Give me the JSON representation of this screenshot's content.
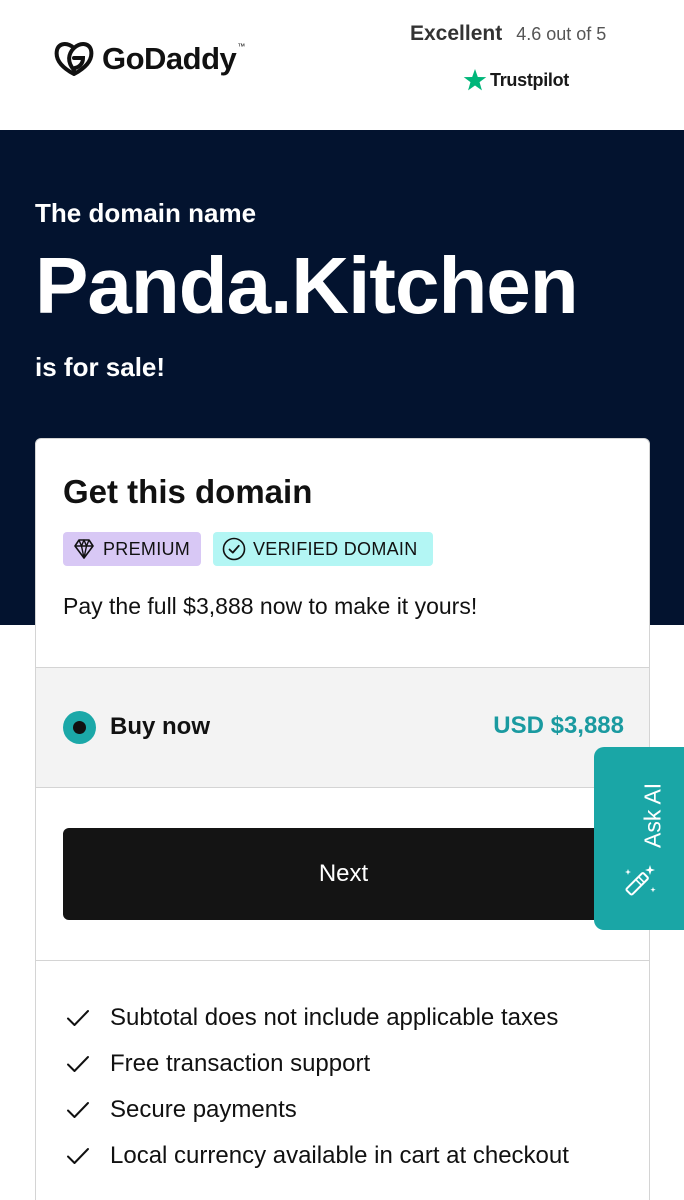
{
  "header": {
    "logo_text": "GoDaddy",
    "logo_tm": "™",
    "logo_icon": "godaddy-logo-icon",
    "rating_label": "Excellent",
    "rating_score": "4.6 out of 5",
    "trustpilot_label": "Trustpilot",
    "trustpilot_icon": "star-icon",
    "trustpilot_color": "#00b67a"
  },
  "hero": {
    "prefix": "The domain name",
    "domain": "Panda.Kitchen",
    "suffix": "is for sale!",
    "background_color": "#03132f"
  },
  "card": {
    "title": "Get this domain",
    "badges": [
      {
        "label": "PREMIUM",
        "icon": "diamond-icon",
        "color": "#d8c8f5"
      },
      {
        "label": "VERIFIED DOMAIN",
        "icon": "check-circle-icon",
        "color": "#b3f6f4"
      }
    ],
    "description": "Pay the full $3,888 now to make it yours!",
    "option": {
      "label": "Buy now",
      "price": "USD $3,888",
      "selected": true,
      "accent_color": "#1ba8a8"
    },
    "next_label": "Next",
    "features": [
      "Subtotal does not include applicable taxes",
      "Free transaction support",
      "Secure payments",
      "Local currency available in cart at checkout"
    ]
  },
  "ask_ai": {
    "label": "Ask AI",
    "icon": "magic-wand-icon",
    "color": "#1aa6a6"
  }
}
